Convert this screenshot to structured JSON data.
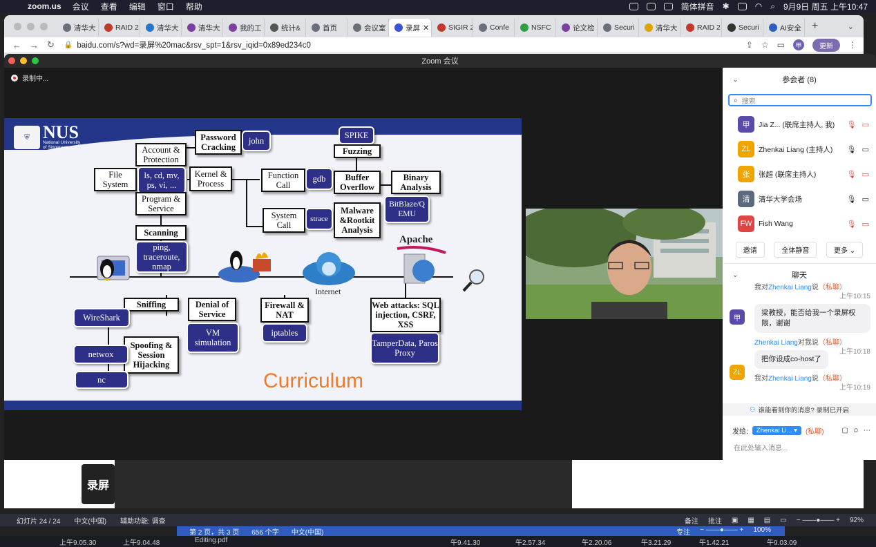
{
  "menubar": {
    "app": "zoom.us",
    "items": [
      "会议",
      "查看",
      "编辑",
      "窗口",
      "帮助"
    ],
    "input_method": "简体拼音",
    "datetime": "9月9日 周五 上午10:47"
  },
  "browser": {
    "tabs": [
      {
        "label": "清华大",
        "color": "#6b6f77"
      },
      {
        "label": "RAID 2",
        "color": "#c0392b"
      },
      {
        "label": "清华大",
        "color": "#2477c9"
      },
      {
        "label": "清华大",
        "color": "#7b3fa1"
      },
      {
        "label": "我的工",
        "color": "#7b3fa1"
      },
      {
        "label": "统计&",
        "color": "#555"
      },
      {
        "label": "首页",
        "color": "#6b6f77"
      },
      {
        "label": "会议室",
        "color": "#6b6f77"
      },
      {
        "label": "录屏",
        "color": "#3a56d4"
      },
      {
        "label": "SIGIR 2",
        "color": "#c0392b"
      },
      {
        "label": "Confe",
        "color": "#6b6f77"
      },
      {
        "label": "NSFC",
        "color": "#2ea043"
      },
      {
        "label": "论文检",
        "color": "#7b3fa1"
      },
      {
        "label": "Securi",
        "color": "#6b6f77"
      },
      {
        "label": "清华大",
        "color": "#e0a400"
      },
      {
        "label": "RAID 2",
        "color": "#c0392b"
      },
      {
        "label": "Securi",
        "color": "#333"
      },
      {
        "label": "AI安全",
        "color": "#2d5dbf"
      }
    ],
    "active_tab_index": 8,
    "url": "baidu.com/s?wd=录屏%20mac&rsv_spt=1&rsv_iqid=0x89ed234c0",
    "update_label": "更新",
    "profile_initial": "甲"
  },
  "zoom": {
    "window_title": "Zoom 会议",
    "recording_label": "录制中...",
    "participants_header": "参会者 (8)",
    "search_placeholder": "搜索",
    "participants": [
      {
        "initial": "甲",
        "name": "Jia Z... (联席主持人, 我)",
        "color": "#5b4aa8",
        "mic_muted": true,
        "video_off": true
      },
      {
        "initial": "ZL",
        "name": "Zhenkai Liang (主持人)",
        "color": "#f0a400",
        "mic_muted": false,
        "video_off": false
      },
      {
        "initial": "张",
        "name": "张超 (联席主持人)",
        "color": "#f0a400",
        "mic_muted": true,
        "video_off": true
      },
      {
        "initial": "清",
        "name": "清华大学会场",
        "color": "#5c6a7d",
        "mic_muted": false,
        "video_off": false
      },
      {
        "initial": "FW",
        "name": "Fish Wang",
        "color": "#e04545",
        "mic_muted": true,
        "video_off": true
      }
    ],
    "buttons": {
      "invite": "邀请",
      "mute_all": "全体静音",
      "more": "更多"
    },
    "chat_header": "聊天",
    "messages": [
      {
        "pre": "我对",
        "name": "Zhenkai Liang",
        "mid": "说",
        "tag": "（私聊）",
        "time": "上午10:15",
        "text": "梁教授，能否给我一个录屏权限，谢谢",
        "avatar": "甲",
        "avatar_color": "#5b4aa8"
      },
      {
        "pre": "",
        "name": "Zhenkai Liang",
        "mid": "对我说",
        "tag": "（私聊）",
        "time": "上午10:18",
        "text": "把你设成co-host了",
        "avatar": "ZL",
        "avatar_color": "#f0a400"
      },
      {
        "pre": "我对",
        "name": "Zhenkai Liang",
        "mid": "说",
        "tag": "（私聊）",
        "time": "上午10:19",
        "text": "",
        "avatar": "",
        "avatar_color": "#5b4aa8"
      }
    ],
    "notice": "谁能看到你的消息? 录制已开启",
    "send_to_label": "发给:",
    "send_to_target": "Zhenkai Li...",
    "send_to_private": "(私聊)",
    "input_placeholder": "在此处输入消息..."
  },
  "slide": {
    "logo": "NUS",
    "logo_sub1": "National University",
    "logo_sub2": "of Singapore",
    "title": "Curriculum",
    "internet": "Internet",
    "apache": "Apache",
    "boxes": {
      "password": "Password Cracking",
      "john": "john",
      "account": "Account & Protection",
      "fs": "File System",
      "ls": "ls, cd, mv, ps, vi, ...",
      "kernel": "Kernel & Process",
      "program": "Program & Service",
      "scanning": "Scanning",
      "ping": "ping, traceroute, nmap",
      "func": "Function Call",
      "gdb": "gdb",
      "spike": "SPIKE",
      "fuzzing": "Fuzzing",
      "buffer": "Buffer Overflow",
      "binary": "Binary Analysis",
      "syscall": "System Call",
      "strace": "strace",
      "malware": "Malware &Rootkit Analysis",
      "bitblaze": "BitBlaze/Q EMU",
      "sniffing": "Sniffing",
      "wireshark": "WireShark",
      "dos": "Denial of Service",
      "vm": "VM simulation",
      "firewall": "Firewall & NAT",
      "iptables": "iptables",
      "webatk": "Web attacks: SQL injection, CSRF, XSS",
      "tamper": "TamperData, Paros Proxy",
      "spoof": "Spoofing & Session Hijacking",
      "netwox": "netwox",
      "nc": "nc"
    }
  },
  "statusbar": {
    "slide": "幻灯片 24 / 24",
    "lang": "中文(中国)",
    "access": "辅助功能: 调查",
    "notes": "备注",
    "comments": "批注",
    "zoom": "92%"
  },
  "wordbar": {
    "page": "第 2 页，共 3 页",
    "words": "656 个字",
    "lang": "中文(中国)",
    "focus": "专注",
    "zoom": "100%"
  },
  "dock": [
    "上午9.05.30",
    "上午9.04.48",
    "Editing.pdf",
    "午9.41.30",
    "午2.57.34",
    "午2.20.06",
    "午3.21.29",
    "午1.42.21",
    "午9.03.09"
  ]
}
